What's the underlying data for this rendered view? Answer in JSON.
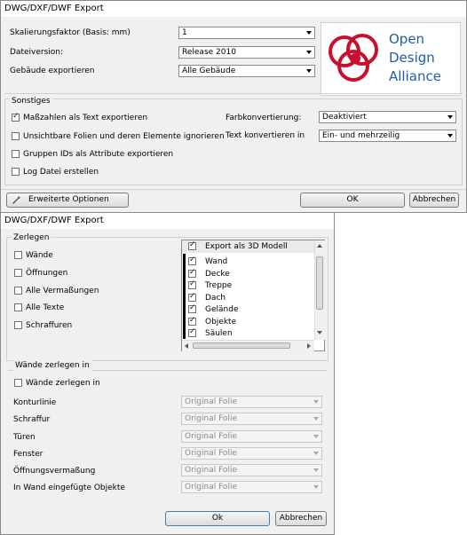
{
  "dialog1": {
    "title": "DWG/DXF/DWF Export",
    "scale_label": "Skalierungsfaktor (Basis: mm)",
    "scale_value": "1",
    "version_label": "Dateiversion:",
    "version_value": "Release 2010",
    "buildings_label": "Gebäude exportieren",
    "buildings_value": "Alle Gebäude",
    "logo": {
      "line1": "Open",
      "line2": "Design",
      "line3": "Alliance",
      "color": "#c8102e",
      "text_color": "#1f5fa8"
    },
    "misc_label": "Sonstiges",
    "checks": [
      {
        "label": "Maßzahlen als Text exportieren",
        "checked": true
      },
      {
        "label": "Unsichtbare Folien und deren Elemente ignorieren",
        "checked": false
      },
      {
        "label": "Gruppen IDs als Attribute exportieren",
        "checked": false
      },
      {
        "label": "Log Datei erstellen",
        "checked": false
      }
    ],
    "color_conv_label": "Farbkonvertierung:",
    "color_conv_value": "Deaktiviert",
    "text_conv_label": "Text konvertieren in",
    "text_conv_value": "Ein- und mehrzeilig",
    "advanced_label": "Erweiterte Optionen",
    "ok_label": "OK",
    "cancel_label": "Abbrechen"
  },
  "dialog2": {
    "title": "DWG/DXF/DWF Export",
    "explode_label": "Zerlegen",
    "explode_checks": [
      "Wände",
      "Öffnungen",
      "Alle Vermaßungen",
      "Alle Texte",
      "Schraffuren"
    ],
    "list_header": "Export als 3D Modell",
    "list_items": [
      "Wand",
      "Decke",
      "Treppe",
      "Dach",
      "Gelände",
      "Objekte",
      "Säulen"
    ],
    "walls_section_label": "Wände zerlegen in",
    "walls_check": "Wände zerlegen in",
    "rows": [
      {
        "label": "Konturlinie",
        "value": "Original Folie"
      },
      {
        "label": "Schraffur",
        "value": "Original Folie"
      },
      {
        "label": "Türen",
        "value": "Original Folie"
      },
      {
        "label": "Fenster",
        "value": "Original Folie"
      },
      {
        "label": "Öffnungsvermaßung",
        "value": "Original Folie"
      },
      {
        "label": "In Wand eingefügte Objekte",
        "value": "Original Folie"
      }
    ],
    "ok_label": "Ok",
    "cancel_label": "Abbrechen"
  }
}
